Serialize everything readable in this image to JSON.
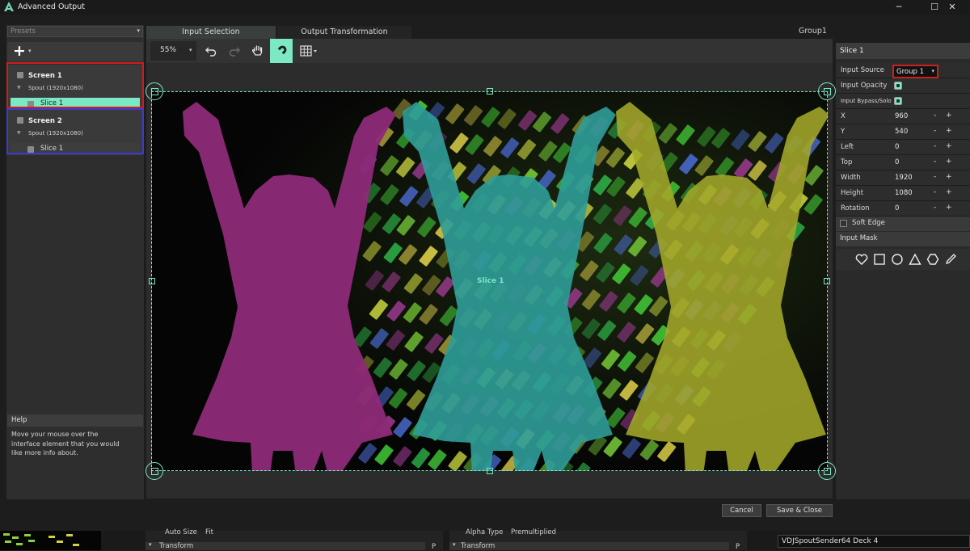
{
  "window": {
    "title": "Advanced Output",
    "minimize_glyph": "─",
    "maximize_glyph": "☐",
    "close_glyph": "✕"
  },
  "left_panel": {
    "presets_placeholder": "Presets",
    "dropdown_glyph": "▾",
    "add_glyph": "+",
    "screens": [
      {
        "name": "Screen 1",
        "source": "Spout (1920x1080)",
        "slices": [
          {
            "name": "Slice 1",
            "selected": true
          }
        ]
      },
      {
        "name": "Screen 2",
        "source": "Spout (1920x1080)",
        "slices": [
          {
            "name": "Slice 1",
            "selected": false
          }
        ]
      }
    ],
    "help_title": "Help",
    "help_text": "Move your mouse over the interface element that you would like more info about."
  },
  "center": {
    "tabs": [
      {
        "label": "Input Selection",
        "active": true
      },
      {
        "label": "Output Transformation",
        "active": false
      }
    ],
    "group_label": "Group1",
    "zoom": "55%",
    "slice_label": "Slice 1",
    "cancel_label": "Cancel",
    "save_label": "Save & Close"
  },
  "right_panel": {
    "title": "Slice 1",
    "input_source_label": "Input Source",
    "input_source_value": "Group 1",
    "input_opacity_label": "Input Opacity",
    "input_bypass_label": "Input Bypass/Solo",
    "props": [
      {
        "label": "X",
        "value": "960"
      },
      {
        "label": "Y",
        "value": "540"
      },
      {
        "label": "Left",
        "value": "0"
      },
      {
        "label": "Top",
        "value": "0"
      },
      {
        "label": "Width",
        "value": "1920"
      },
      {
        "label": "Height",
        "value": "1080"
      },
      {
        "label": "Rotation",
        "value": "0"
      }
    ],
    "minus": "-",
    "plus": "+",
    "soft_edge_label": "Soft Edge",
    "input_mask_label": "Input Mask"
  },
  "bottom": {
    "auto_size_label": "Auto Size",
    "auto_size_value": "Fit",
    "transform_label": "Transform",
    "alpha_type_label": "Alpha Type",
    "alpha_type_value": "Premultiplied",
    "p_label": "P",
    "deck_label": "VDJSpoutSender64 Deck 4"
  },
  "colors": {
    "accent": "#7ce8c4",
    "screen1_highlight": "#d01c1c",
    "screen2_highlight": "#3b3bd0",
    "silhouette_magenta": "#8e2a78",
    "silhouette_teal": "#2f9d99",
    "silhouette_yellow": "#a3a82a"
  }
}
